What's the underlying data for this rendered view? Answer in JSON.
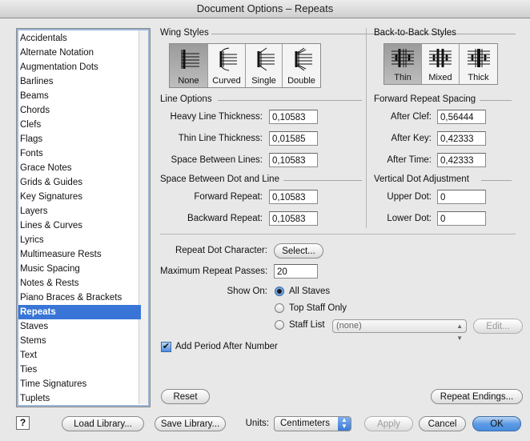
{
  "window": {
    "title": "Document Options – Repeats"
  },
  "sidebar": {
    "items": [
      "Accidentals",
      "Alternate Notation",
      "Augmentation Dots",
      "Barlines",
      "Beams",
      "Chords",
      "Clefs",
      "Flags",
      "Fonts",
      "Grace Notes",
      "Grids & Guides",
      "Key Signatures",
      "Layers",
      "Lines & Curves",
      "Lyrics",
      "Multimeasure Rests",
      "Music Spacing",
      "Notes & Rests",
      "Piano Braces & Brackets",
      "Repeats",
      "Staves",
      "Stems",
      "Text",
      "Ties",
      "Time Signatures",
      "Tuplets"
    ],
    "selected": "Repeats"
  },
  "wing_styles": {
    "title": "Wing Styles",
    "options": [
      "None",
      "Curved",
      "Single",
      "Double"
    ],
    "selected": "None"
  },
  "back_to_back": {
    "title": "Back-to-Back Styles",
    "options": [
      "Thin",
      "Mixed",
      "Thick"
    ],
    "selected": "Thin"
  },
  "line_options": {
    "title": "Line Options",
    "heavy_label": "Heavy Line Thickness:",
    "heavy_value": "0,10583",
    "thin_label": "Thin Line Thickness:",
    "thin_value": "0,01585",
    "space_label": "Space Between Lines:",
    "space_value": "0,10583"
  },
  "dot_line": {
    "title": "Space Between Dot and Line",
    "forward_label": "Forward Repeat:",
    "forward_value": "0,10583",
    "backward_label": "Backward Repeat:",
    "backward_value": "0,10583"
  },
  "forward_spacing": {
    "title": "Forward Repeat Spacing",
    "clef_label": "After Clef:",
    "clef_value": "0,56444",
    "key_label": "After Key:",
    "key_value": "0,42333",
    "time_label": "After Time:",
    "time_value": "0,42333"
  },
  "vertical_dot": {
    "title": "Vertical Dot Adjustment",
    "upper_label": "Upper Dot:",
    "upper_value": "0",
    "lower_label": "Lower Dot:",
    "lower_value": "0"
  },
  "repeat_dot": {
    "label": "Repeat Dot Character:",
    "button": "Select..."
  },
  "max_passes": {
    "label": "Maximum Repeat Passes:",
    "value": "20"
  },
  "show_on": {
    "label": "Show On:",
    "all": "All Staves",
    "top": "Top Staff Only",
    "list": "Staff List",
    "selected": "All Staves",
    "staff_list_value": "(none)",
    "edit_button": "Edit..."
  },
  "add_period": {
    "label": "Add Period After Number",
    "checked": true
  },
  "buttons": {
    "reset": "Reset",
    "repeat_endings": "Repeat Endings...",
    "load_library": "Load Library...",
    "save_library": "Save Library...",
    "units_label": "Units:",
    "units_value": "Centimeters",
    "apply": "Apply",
    "cancel": "Cancel",
    "ok": "OK",
    "help": "?"
  },
  "colors": {
    "selection": "#3875d7",
    "default_button": "#4a8de0"
  }
}
